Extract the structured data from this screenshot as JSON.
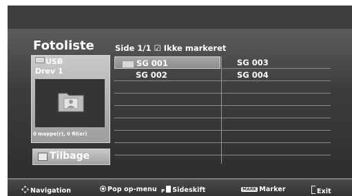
{
  "header": {
    "title": "Fotoliste",
    "page_info": "Side 1/1  ☑ Ikke markeret"
  },
  "source": {
    "device": "USB",
    "drive": "Drev 1",
    "counts": "0 mappe(r), 0 fil(er)"
  },
  "back_button": {
    "label": "Tilbage"
  },
  "files": [
    {
      "name": "SG 001",
      "selected": true
    },
    {
      "name": "SG 002",
      "selected": false
    },
    {
      "name": "SG 003",
      "selected": false
    },
    {
      "name": "SG 004",
      "selected": false
    }
  ],
  "footer": {
    "navigation": "Navigation",
    "popup": "Pop op-menu",
    "page_change": "Sideskift",
    "mark_key": "MARK",
    "mark": "Marker",
    "exit": "Exit"
  },
  "icons": [
    "usb-icon",
    "folder-icon",
    "navigation-icon",
    "ok-icon",
    "page-icon",
    "exit-icon"
  ]
}
